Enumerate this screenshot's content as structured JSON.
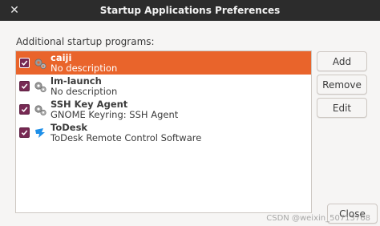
{
  "window": {
    "title": "Startup Applications Preferences"
  },
  "main": {
    "section_label": "Additional startup programs:",
    "programs": [
      {
        "name": "caiji",
        "description": "No description",
        "checked": true,
        "selected": true,
        "icon": "gear-icon"
      },
      {
        "name": "lm-launch",
        "description": "No description",
        "checked": true,
        "selected": false,
        "icon": "gear-icon"
      },
      {
        "name": "SSH Key Agent",
        "description": "GNOME Keyring: SSH Agent",
        "checked": true,
        "selected": false,
        "icon": "gear-icon"
      },
      {
        "name": "ToDesk",
        "description": "ToDesk Remote Control Software",
        "checked": true,
        "selected": false,
        "icon": "todesk-icon"
      }
    ]
  },
  "buttons": {
    "add": "Add",
    "remove": "Remove",
    "edit": "Edit",
    "close": "Close"
  },
  "watermark": "CSDN @weixin_50713768",
  "colors": {
    "selection": "#e9642b",
    "checkbox": "#772953",
    "titlebar": "#2c2c2c"
  }
}
